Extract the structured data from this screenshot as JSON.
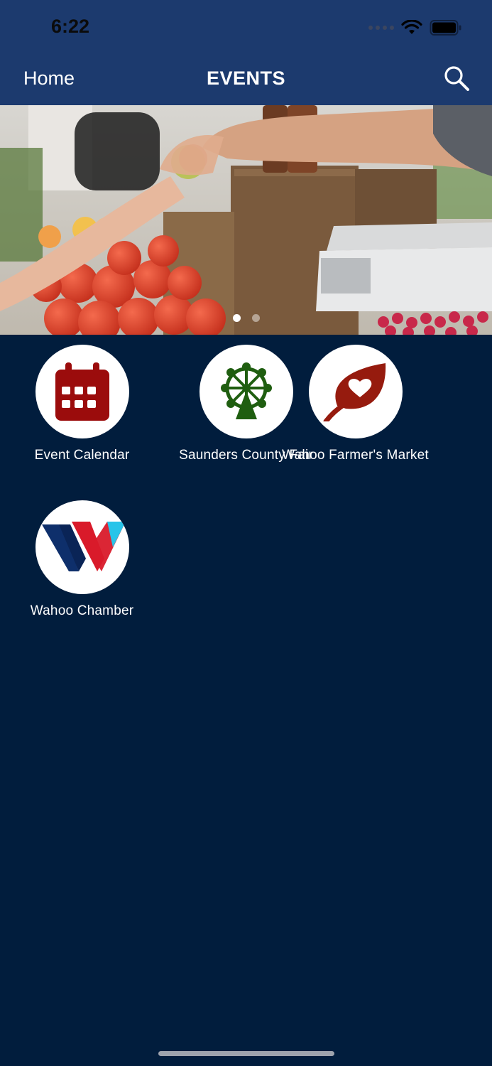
{
  "status": {
    "time": "6:22"
  },
  "nav": {
    "back_label": "Home",
    "title": "EVENTS"
  },
  "banner": {
    "page_count": 2,
    "active_page": 1
  },
  "tiles": [
    {
      "label": "Event Calendar",
      "icon": "calendar-icon",
      "color": "#9b0c0c"
    },
    {
      "label": "Saunders County Fair",
      "icon": "ferris-wheel-icon",
      "color": "#1f5e10"
    },
    {
      "label": "Wahoo Farmer's Market",
      "icon": "leaf-heart-icon",
      "color": "#961b0e"
    },
    {
      "label": "Wahoo Chamber",
      "icon": "wahoo-w-logo",
      "color": "#0e2f6b"
    }
  ],
  "colors": {
    "nav_bar": "#1c3a6e",
    "background": "#011d3d"
  }
}
